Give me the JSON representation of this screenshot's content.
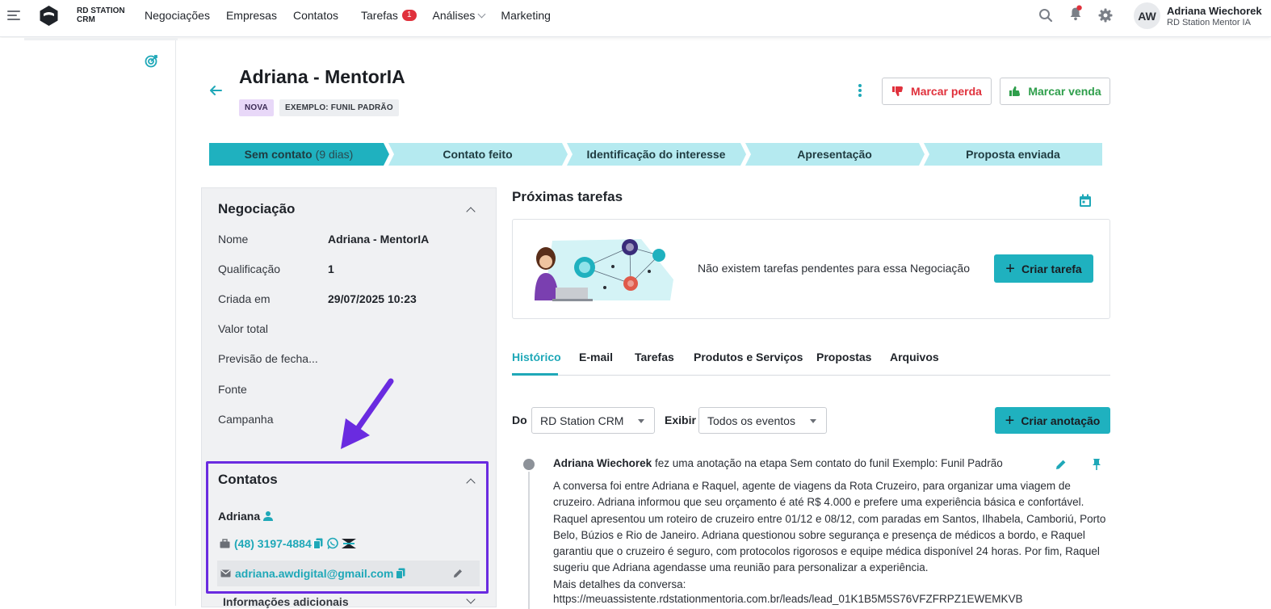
{
  "topbar": {
    "brand_line1": "RD STATION",
    "brand_line2": "CRM",
    "nav": [
      {
        "label": "Negociações"
      },
      {
        "label": "Empresas"
      },
      {
        "label": "Contatos"
      },
      {
        "label": "Tarefas",
        "badge": "1"
      },
      {
        "label": "Análises",
        "dropdown": true
      },
      {
        "label": "Marketing"
      }
    ],
    "user": {
      "initials": "AW",
      "name": "Adriana Wiechorek",
      "org": "RD Station Mentor IA"
    }
  },
  "deal": {
    "title": "Adriana - MentorIA",
    "tag_status": "NOVA",
    "tag_funnel": "EXEMPLO: FUNIL PADRÃO",
    "mark_loss": "Marcar perda",
    "mark_sale": "Marcar venda"
  },
  "pipeline": [
    {
      "label": "Sem contato",
      "extra": "(9 dias)",
      "active": true
    },
    {
      "label": "Contato feito",
      "extra": ""
    },
    {
      "label": "Identificação do interesse",
      "extra": ""
    },
    {
      "label": "Apresentação",
      "extra": ""
    },
    {
      "label": "Proposta enviada",
      "extra": ""
    }
  ],
  "negociacao": {
    "title": "Negociação",
    "fields": [
      {
        "label": "Nome",
        "value": "Adriana - MentorIA"
      },
      {
        "label": "Qualificação",
        "value": "1"
      },
      {
        "label": "Criada em",
        "value": "29/07/2025 10:23"
      },
      {
        "label": "Valor total",
        "value": ""
      },
      {
        "label": "Previsão de fecha...",
        "value": ""
      },
      {
        "label": "Fonte",
        "value": ""
      },
      {
        "label": "Campanha",
        "value": ""
      }
    ]
  },
  "contatos": {
    "title": "Contatos",
    "name": "Adriana",
    "phone": "(48) 3197-4884",
    "email": "adriana.awdigital@gmail.com",
    "more_info": "Informações adicionais"
  },
  "tasks": {
    "title": "Próximas tarefas",
    "empty": "Não existem tarefas pendentes para essa Negociação",
    "create": "Criar tarefa"
  },
  "tabs": [
    "Histórico",
    "E-mail",
    "Tarefas",
    "Produtos e Serviços",
    "Propostas",
    "Arquivos"
  ],
  "filters": {
    "from_label": "Do",
    "from_value": "RD Station CRM",
    "show_label": "Exibir",
    "show_value": "Todos os eventos",
    "create_note": "Criar anotação"
  },
  "note": {
    "author": "Adriana Wiechorek",
    "action": "fez uma anotação na etapa Sem contato do funil Exemplo: Funil Padrão",
    "body": "A conversa foi entre Adriana e Raquel, agente de viagens da Rota Cruzeiro, para organizar uma viagem de cruzeiro. Adriana informou que seu orçamento é até R$ 4.000 e prefere uma experiência básica e confortável. Raquel apresentou um roteiro de cruzeiro entre 01/12 e 08/12, com paradas em Santos, Ilhabela, Camboriú, Porto Belo, Búzios e Rio de Janeiro. Adriana questionou sobre segurança e presença de médicos a bordo, e Raquel garantiu que o cruzeiro é seguro, com protocolos rigorosos e equipe médica disponível 24 horas. Por fim, Raquel sugeriu que Adriana agendasse uma reunião para personalizar a experiência.",
    "more_label": "Mais detalhes da conversa:",
    "link": "https://meuassistente.rdstationmentoria.com.br/leads/lead_01K1B5M5S76VFZFRPZ1EWEMKVB"
  },
  "colors": {
    "accent": "#1fa8b8",
    "highlight": "#6a2be0",
    "loss": "#e0313c",
    "sale": "#2e9e4b",
    "stage_active": "#1fb1bf",
    "stage": "#b5eaf0"
  }
}
